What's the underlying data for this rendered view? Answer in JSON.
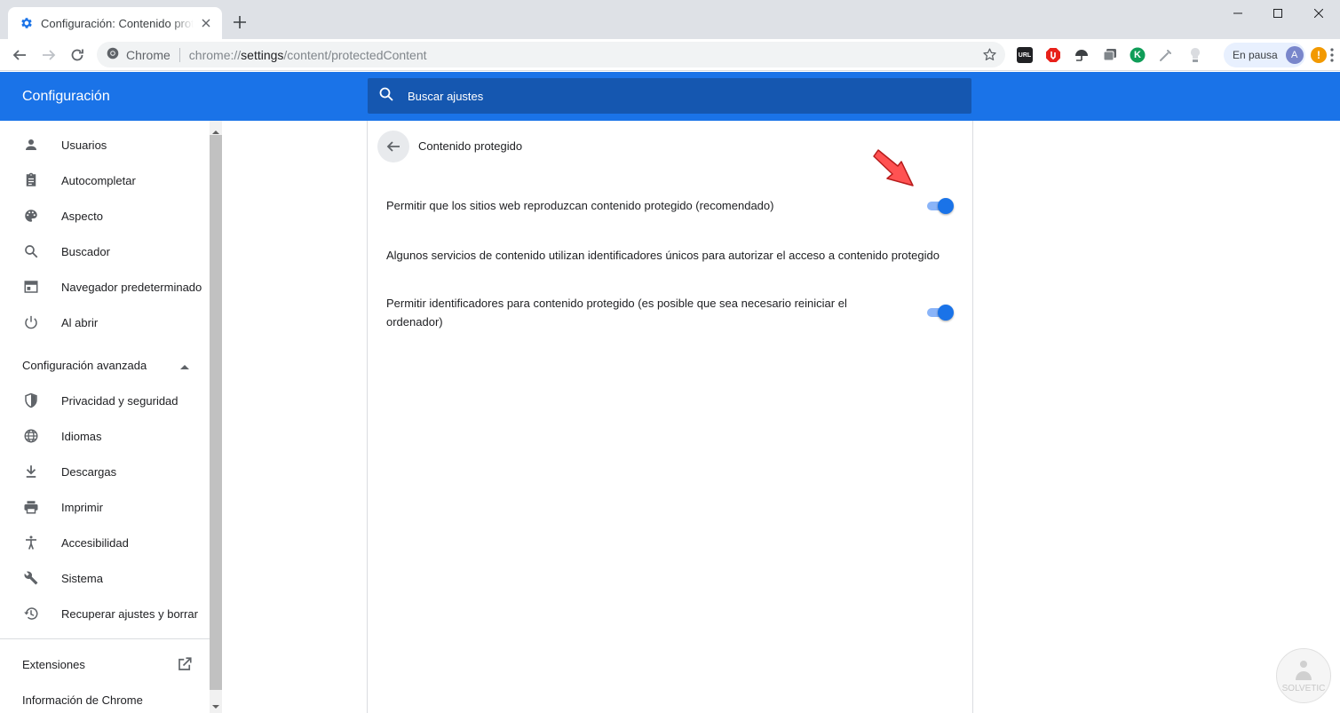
{
  "tab": {
    "title": "Configuración: Contenido protegido",
    "new_tab": "+"
  },
  "window_controls": {
    "minimize": "minimize",
    "maximize": "maximize",
    "close": "close"
  },
  "omnibox": {
    "site_label": "Chrome",
    "url_scheme": "chrome://",
    "url_host": "settings",
    "url_path": "/content/protectedContent"
  },
  "extensions": [
    {
      "icon": "url-extension-icon",
      "label": "URL"
    },
    {
      "icon": "adblock-icon",
      "label": ""
    },
    {
      "icon": "umbrella-extension-icon",
      "label": ""
    },
    {
      "icon": "tabs-extension-icon",
      "label": ""
    },
    {
      "icon": "k-extension-icon",
      "label": "K"
    },
    {
      "icon": "eyedropper-extension-icon",
      "label": ""
    },
    {
      "icon": "lightbulb-extension-icon",
      "label": ""
    }
  ],
  "profile": {
    "status": "En pausa",
    "avatar_letter": "A",
    "alert": "!"
  },
  "header": {
    "title": "Configuración",
    "search_placeholder": "Buscar ajustes"
  },
  "sidebar": {
    "items": [
      {
        "label": "Usuarios",
        "icon": "person-icon"
      },
      {
        "label": "Autocompletar",
        "icon": "clipboard-icon"
      },
      {
        "label": "Aspecto",
        "icon": "palette-icon"
      },
      {
        "label": "Buscador",
        "icon": "search-icon"
      },
      {
        "label": "Navegador predeterminado",
        "icon": "browser-icon"
      },
      {
        "label": "Al abrir",
        "icon": "power-icon"
      }
    ],
    "advanced_label": "Configuración avanzada",
    "advanced_items": [
      {
        "label": "Privacidad y seguridad",
        "icon": "shield-icon"
      },
      {
        "label": "Idiomas",
        "icon": "globe-icon"
      },
      {
        "label": "Descargas",
        "icon": "download-icon"
      },
      {
        "label": "Imprimir",
        "icon": "printer-icon"
      },
      {
        "label": "Accesibilidad",
        "icon": "accessibility-icon"
      },
      {
        "label": "Sistema",
        "icon": "wrench-icon"
      },
      {
        "label": "Recuperar ajustes y borrar",
        "icon": "restore-icon"
      }
    ],
    "extensions_label": "Extensiones",
    "about_label": "Información de Chrome"
  },
  "content": {
    "title": "Contenido protegido",
    "rows": [
      {
        "text": "Permitir que los sitios web reproduzcan contenido protegido (recomendado)",
        "toggle": true
      },
      {
        "text": "Algunos servicios de contenido utilizan identificadores únicos para autorizar el acceso a contenido protegido"
      },
      {
        "text": "Permitir identificadores para contenido protegido (es posible que sea necesario reiniciar el ordenador)",
        "toggle": true
      }
    ]
  },
  "colors": {
    "header_blue": "#1a73e8",
    "search_blue": "#1557b0",
    "toggle_on": "#1a73e8",
    "annotation_arrow": "#ff5252"
  }
}
